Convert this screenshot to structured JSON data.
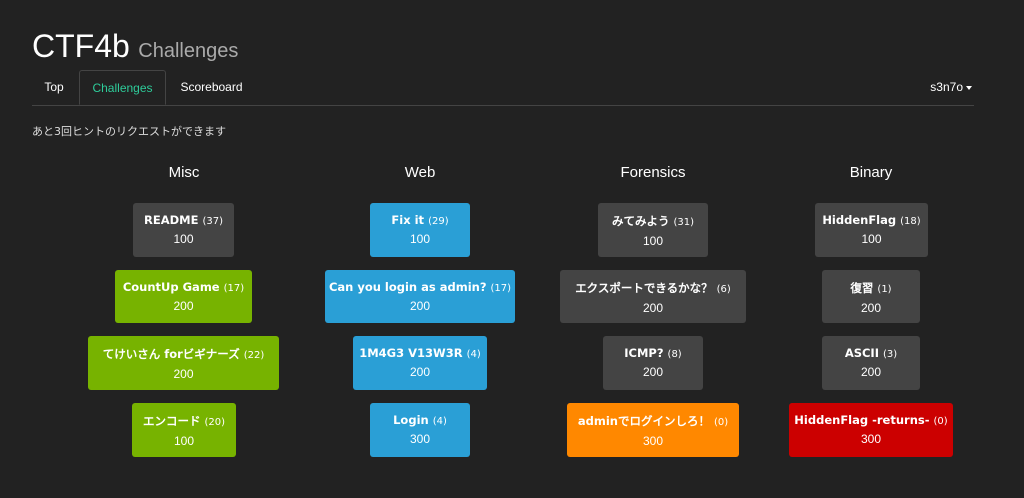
{
  "header": {
    "title": "CTF4b",
    "subtitle": "Challenges"
  },
  "nav": {
    "tabs": [
      {
        "label": "Top"
      },
      {
        "label": "Challenges"
      },
      {
        "label": "Scoreboard"
      }
    ],
    "user": "s3n7o"
  },
  "hint_message": "あと3回ヒントのリクエストができます",
  "colors": {
    "solved": "#444444",
    "misc": "#77b300",
    "web": "#2a9fd6",
    "forensics": "#ff8800",
    "binary": "#cc0000",
    "active_tab": "#2ecc9a"
  },
  "categories": [
    {
      "name": "Misc",
      "challenges": [
        {
          "name": "README",
          "count": "(37)",
          "points": "100"
        },
        {
          "name": "CountUp Game",
          "count": "(17)",
          "points": "200"
        },
        {
          "name": "てけいさん forビギナーズ",
          "count": "(22)",
          "points": "200"
        },
        {
          "name": "エンコード",
          "count": "(20)",
          "points": "100"
        }
      ]
    },
    {
      "name": "Web",
      "challenges": [
        {
          "name": "Fix it",
          "count": "(29)",
          "points": "100"
        },
        {
          "name": "Can you login as admin?",
          "count": "(17)",
          "points": "200"
        },
        {
          "name": "1M4G3 V13W3R",
          "count": "(4)",
          "points": "200"
        },
        {
          "name": "Login",
          "count": "(4)",
          "points": "300"
        }
      ]
    },
    {
      "name": "Forensics",
      "challenges": [
        {
          "name": "みてみよう",
          "count": "(31)",
          "points": "100"
        },
        {
          "name": "エクスポートできるかな？",
          "count": "(6)",
          "points": "200"
        },
        {
          "name": "ICMP?",
          "count": "(8)",
          "points": "200"
        },
        {
          "name": "adminでログインしろ！",
          "count": "(0)",
          "points": "300"
        }
      ]
    },
    {
      "name": "Binary",
      "challenges": [
        {
          "name": "HiddenFlag",
          "count": "(18)",
          "points": "100"
        },
        {
          "name": "復習",
          "count": "(1)",
          "points": "200"
        },
        {
          "name": "ASCII",
          "count": "(3)",
          "points": "200"
        },
        {
          "name": "HiddenFlag -returns-",
          "count": "(0)",
          "points": "300"
        }
      ]
    }
  ]
}
